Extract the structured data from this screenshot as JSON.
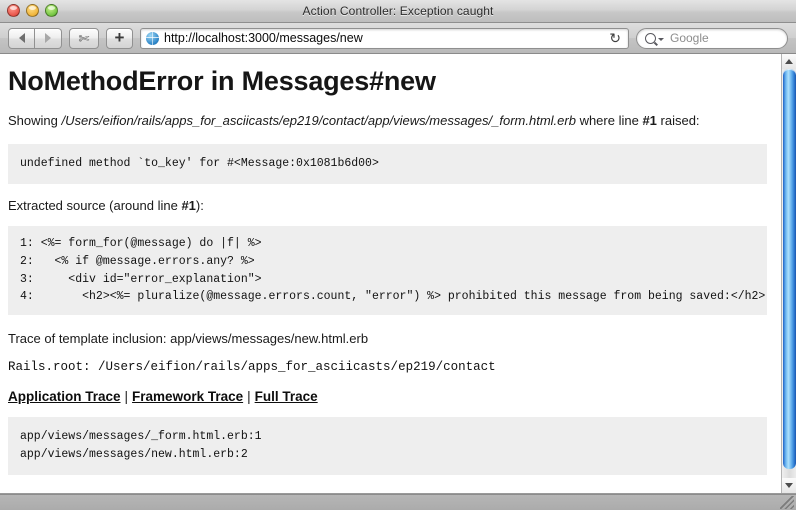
{
  "window": {
    "title": "Action Controller: Exception caught",
    "traffic_lights": [
      "close",
      "minimize",
      "zoom"
    ]
  },
  "toolbar": {
    "back_label": "Back",
    "forward_label": "Forward",
    "snippet_icon": "✄",
    "add_tab_label": "+",
    "url": "http://localhost:3000/messages/new",
    "reload_glyph": "↻",
    "search_placeholder": "Google"
  },
  "page": {
    "title": "NoMethodError in Messages#new",
    "showing_prefix": "Showing ",
    "showing_path": "/Users/eifion/rails/apps_for_asciicasts/ep219/contact/app/views/messages/_form.html.erb",
    "showing_mid": " where line ",
    "showing_lineno": "#1",
    "showing_suffix": " raised:",
    "error_message": "undefined method `to_key' for #<Message:0x1081b6d00>",
    "extracted_prefix": "Extracted source (around line ",
    "extracted_lineno": "#1",
    "extracted_suffix": "):",
    "source_lines": "1: <%= form_for(@message) do |f| %>\n2:   <% if @message.errors.any? %>\n3:     <div id=\"error_explanation\">\n4:       <h2><%= pluralize(@message.errors.count, \"error\") %> prohibited this message from being saved:</h2>",
    "template_trace": "Trace of template inclusion: app/views/messages/new.html.erb",
    "rails_root": "Rails.root: /Users/eifion/rails/apps_for_asciicasts/ep219/contact",
    "trace_links": [
      {
        "label": "Application Trace"
      },
      {
        "label": "Framework Trace"
      },
      {
        "label": "Full Trace"
      }
    ],
    "trace_separator": "|",
    "backtrace": "app/views/messages/_form.html.erb:1\napp/views/messages/new.html.erb:2"
  },
  "scrollbar": {
    "up_arrow": "up-arrow",
    "down_arrow": "down-arrow"
  },
  "colors": {
    "code_background": "#eeeeee",
    "scrollbar_accent": "#6fb9f2",
    "page_background": "#ffffff"
  }
}
